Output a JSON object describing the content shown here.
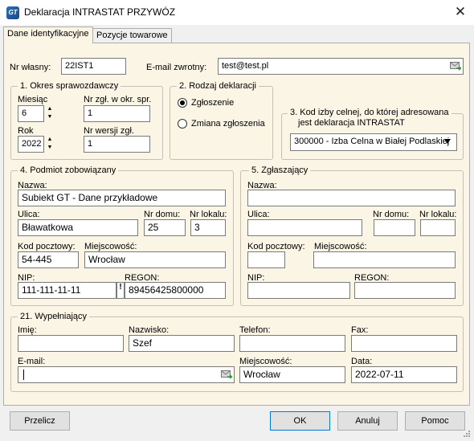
{
  "window": {
    "title": "Deklaracja INTRASTAT PRZYWÓZ",
    "app_icon_text": "GT",
    "close_glyph": "✕"
  },
  "tabs": [
    {
      "label": "Dane identyfikacyjne",
      "active": true
    },
    {
      "label": "Pozycje towarowe",
      "active": false
    }
  ],
  "header": {
    "nr_label": "Nr własny:",
    "nr_value": "22IST1",
    "email_label": "E-mail zwrotny:",
    "email_value": "test@test.pl"
  },
  "okres": {
    "title": "1. Okres sprawozdawczy",
    "miesiac_label": "Miesiąc",
    "miesiac_value": "6",
    "nr_zgl_label": "Nr zgł. w okr. spr.",
    "nr_zgl_value": "1",
    "rok_label": "Rok",
    "rok_value": "2022",
    "nr_wersji_label": "Nr wersji zgł.",
    "nr_wersji_value": "1"
  },
  "rodzaj": {
    "title": "2. Rodzaj deklaracji",
    "options": [
      {
        "label": "Zgłoszenie",
        "selected": true
      },
      {
        "label": "Zmiana zgłoszenia",
        "selected": false
      }
    ]
  },
  "kod_izby": {
    "title_line1": "3. Kod izby celnej, do której adresowana",
    "title_line2": "jest deklaracja INTRASTAT",
    "value": "300000 - Izba Celna w Białej Podlaskiej"
  },
  "podmiot": {
    "title": "4. Podmiot zobowiązany",
    "nazwa_label": "Nazwa:",
    "nazwa_value": "Subiekt GT - Dane przykładowe",
    "ulica_label": "Ulica:",
    "ulica_value": "Bławatkowa",
    "nr_domu_label": "Nr domu:",
    "nr_domu_value": "25",
    "nr_lokalu_label": "Nr lokalu:",
    "nr_lokalu_value": "3",
    "kod_label": "Kod pocztowy:",
    "kod_value": "54-445",
    "miejscowosc_label": "Miejscowość:",
    "miejscowosc_value": "Wrocław",
    "nip_label": "NIP:",
    "nip_value": "111-111-11-11",
    "nip_warning": "!",
    "regon_label": "REGON:",
    "regon_value": "89456425800000"
  },
  "zglaszajacy": {
    "title": "5. Zgłaszający",
    "nazwa_label": "Nazwa:",
    "nazwa_value": "",
    "ulica_label": "Ulica:",
    "ulica_value": "",
    "nr_domu_label": "Nr domu:",
    "nr_domu_value": "",
    "nr_lokalu_label": "Nr lokalu:",
    "nr_lokalu_value": "",
    "kod_label": "Kod pocztowy:",
    "kod_value": "",
    "miejscowosc_label": "Miejscowość:",
    "miejscowosc_value": "",
    "nip_label": "NIP:",
    "nip_value": "",
    "regon_label": "REGON:",
    "regon_value": ""
  },
  "wypelniajacy": {
    "title": "21. Wypełniający",
    "imie_label": "Imię:",
    "imie_value": "",
    "nazwisko_label": "Nazwisko:",
    "nazwisko_value": "Szef",
    "telefon_label": "Telefon:",
    "telefon_value": "",
    "fax_label": "Fax:",
    "fax_value": "",
    "email_label": "E-mail:",
    "email_value": "",
    "miejscowosc_label": "Miejscowość:",
    "miejscowosc_value": "Wrocław",
    "data_label": "Data:",
    "data_value": "2022-07-11"
  },
  "buttons": {
    "przelicz": "Przelicz",
    "ok": "OK",
    "anuluj": "Anuluj",
    "pomoc": "Pomoc"
  },
  "colors": {
    "panel_bg": "#fbf5e6",
    "window_bg": "#f0f0f0",
    "accent_border": "#0078d7"
  }
}
